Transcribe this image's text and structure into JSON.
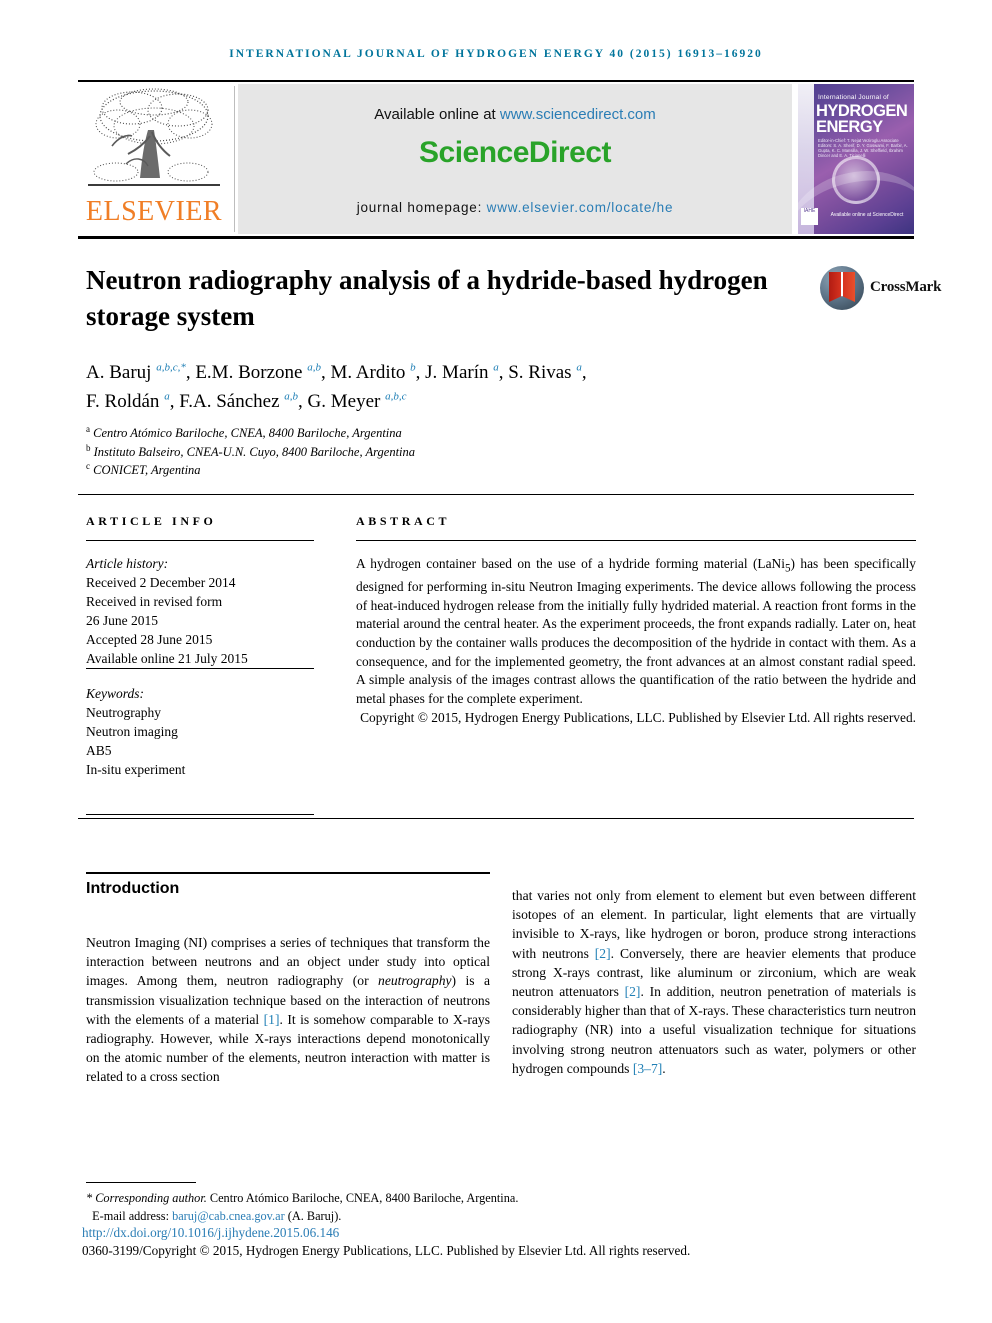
{
  "running_head": "International Journal of Hydrogen Energy 40 (2015) 16913–16920",
  "masthead": {
    "publisher_name": "ELSEVIER",
    "available_prefix": "Available online at ",
    "available_url": "www.sciencedirect.com",
    "sciencedirect_logo": "ScienceDirect",
    "homepage_prefix": "journal homepage: ",
    "homepage_url": "www.elsevier.com/locate/he",
    "cover": {
      "line1": "International Journal of",
      "line2": "HYDROGEN",
      "line3": "ENERGY",
      "editors": "Editor-in-Chief: T. Nejat Veziroglu   Associate Editors: S. A. Sherif, D. Y. Goswami, F. Barbir, A. Gupta, K. C. Mansilla, J. W. Sheffield, Ibrahim Dincer and E. A. Ticianelli",
      "badge": "IAHE",
      "footer": "Available online at ScienceDirect"
    }
  },
  "article": {
    "title": "Neutron radiography analysis of a hydride-based hydrogen storage system",
    "crossmark_label": "CrossMark",
    "authors_line1_html": "A. Baruj <sup>a,b,c,*</sup>, E.M. Borzone <sup>a,b</sup>, M. Ardito <sup>b</sup>, J. Marín <sup>a</sup>, S. Rivas <sup>a</sup>,",
    "authors_line2_html": "F. Roldán <sup>a</sup>, F.A. Sánchez <sup>a,b</sup>, G. Meyer <sup>a,b,c</sup>",
    "affiliations": [
      {
        "mark": "a",
        "text": "Centro Atómico Bariloche, CNEA, 8400 Bariloche, Argentina"
      },
      {
        "mark": "b",
        "text": "Instituto Balseiro, CNEA-U.N. Cuyo, 8400 Bariloche, Argentina"
      },
      {
        "mark": "c",
        "text": "CONICET, Argentina"
      }
    ]
  },
  "info": {
    "heading": "Article info",
    "history_label": "Article history:",
    "history": [
      "Received 2 December 2014",
      "Received in revised form",
      "26 June 2015",
      "Accepted 28 June 2015",
      "Available online 21 July 2015"
    ],
    "keywords_label": "Keywords:",
    "keywords": [
      "Neutrography",
      "Neutron imaging",
      "AB5",
      "In-situ experiment"
    ]
  },
  "abstract": {
    "heading": "Abstract",
    "text_html": "A hydrogen container based on the use of a hydride forming material (LaNi<sub>5</sub>) has been specifically designed for performing in-situ Neutron Imaging experiments. The device allows following the process of heat-induced hydrogen release from the initially fully hydrided material. A reaction front forms in the material around the central heater. As the experiment proceeds, the front expands radially. Later on, heat conduction by the container walls produces the decomposition of the hydride in contact with them. As a consequence, and for the implemented geometry, the front advances at an almost constant radial speed. A simple analysis of the images contrast allows the quantification of the ratio between the hydride and metal phases for the complete experiment.",
    "copyright": "Copyright © 2015, Hydrogen Energy Publications, LLC. Published by Elsevier Ltd. All rights reserved."
  },
  "body": {
    "section_title": "Introduction",
    "left_column_html": "Neutron Imaging (NI) comprises a series of techniques that transform the interaction between neutrons and an object under study into optical images. Among them, neutron radiography (or <i>neutrography</i>) is a transmission visualization technique based on the interaction of neutrons with the elements of a material <span class=\"ref\">[1]</span>. It is somehow comparable to X-rays radiography. However, while X-rays interactions depend monotonically on the atomic number of the elements, neutron interaction with matter is related to a cross section",
    "right_column_html": "that varies not only from element to element but even between different isotopes of an element. In particular, light elements that are virtually invisible to X-rays, like hydrogen or boron, produce strong interactions with neutrons <span class=\"ref\">[2]</span>. Conversely, there are heavier elements that produce strong X-rays contrast, like aluminum or zirconium, which are weak neutron attenuators <span class=\"ref\">[2]</span>. In addition, neutron penetration of materials is considerably higher than that of X-rays. These characteristics turn neutron radiography (NR) into a useful visualization technique for situations involving strong neutron attenuators such as water, polymers or other hydrogen compounds <span class=\"ref\">[3–7]</span>."
  },
  "footer": {
    "corresponding_html": "<span class=\"it\">* Corresponding author.</span> Centro Atómico Bariloche, CNEA, 8400 Bariloche, Argentina.",
    "email_label": "E-mail address: ",
    "email": "baruj@cab.cnea.gov.ar",
    "email_suffix": " (A. Baruj).",
    "doi": "http://dx.doi.org/10.1016/j.ijhydene.2015.06.146",
    "issn_line": "0360-3199/Copyright © 2015, Hydrogen Energy Publications, LLC. Published by Elsevier Ltd. All rights reserved."
  }
}
